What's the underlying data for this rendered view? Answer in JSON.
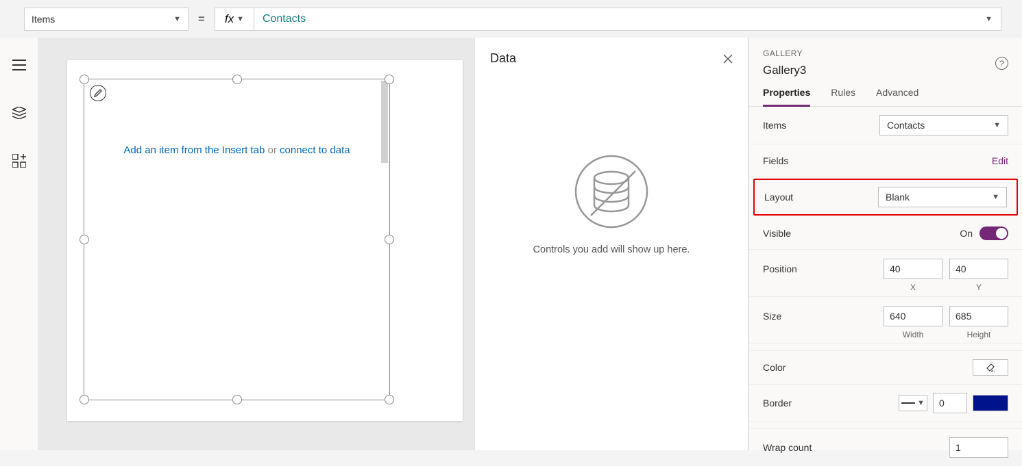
{
  "formula_bar": {
    "property": "Items",
    "formula": "Contacts",
    "fx_label": "fx"
  },
  "canvas": {
    "hint_link": "Add an item from the Insert tab",
    "hint_or": " or ",
    "hint_connect": "connect to data"
  },
  "data_pane": {
    "title": "Data",
    "empty_caption": "Controls you add will show up here."
  },
  "prop_panel": {
    "category": "GALLERY",
    "name": "Gallery3",
    "tabs": {
      "properties": "Properties",
      "rules": "Rules",
      "advanced": "Advanced"
    },
    "items_label": "Items",
    "items_value": "Contacts",
    "fields_label": "Fields",
    "fields_edit": "Edit",
    "layout_label": "Layout",
    "layout_value": "Blank",
    "visible_label": "Visible",
    "visible_value": "On",
    "position_label": "Position",
    "position_x": "40",
    "position_y": "40",
    "pos_x_cap": "X",
    "pos_y_cap": "Y",
    "size_label": "Size",
    "size_w": "640",
    "size_h": "685",
    "size_w_cap": "Width",
    "size_h_cap": "Height",
    "color_label": "Color",
    "border_label": "Border",
    "border_value": "0",
    "wrap_label": "Wrap count",
    "wrap_value": "1"
  }
}
